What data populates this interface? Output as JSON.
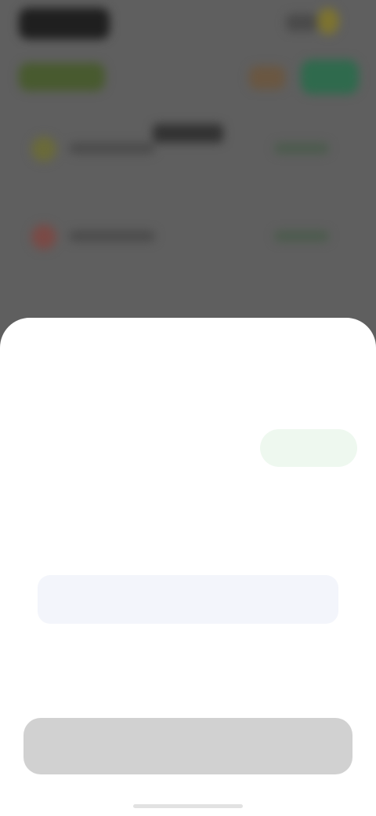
{
  "background": {
    "description_icons": {
      "top_left_badge": "dark-pill",
      "coin": "coin-icon",
      "leaf": "leaf-icon",
      "orange": "orange-chip",
      "green_button": "green-button",
      "row_icons": [
        "coin-icon",
        "fire-icon"
      ]
    }
  },
  "sheet": {
    "title": "",
    "subtitle": "",
    "balance_label": "",
    "balance_value": "",
    "picker": {
      "items": [
        "",
        "",
        "",
        "",
        ""
      ],
      "selected_index": 2
    },
    "confirm_label": ""
  },
  "colors": {
    "overlay": "#5f5f5f",
    "sheet": "#ffffff",
    "accent_green": "#2e6d42",
    "button_disabled": "#d1d1d1"
  }
}
